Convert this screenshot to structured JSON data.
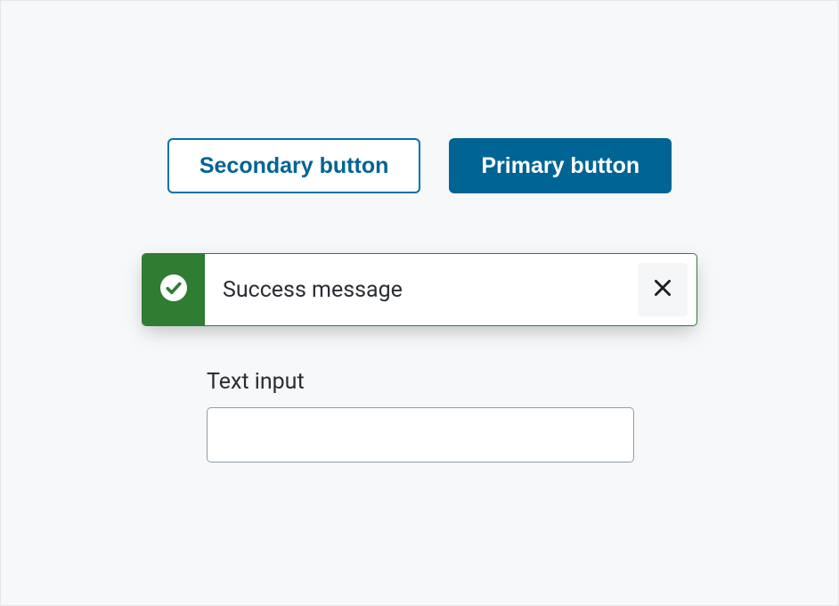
{
  "buttons": {
    "secondary_label": "Secondary button",
    "primary_label": "Primary button"
  },
  "alert": {
    "type": "success",
    "message": "Success message",
    "icon_name": "check-circle-icon",
    "close_icon_name": "close-icon",
    "accent_color": "#2e7d32"
  },
  "form": {
    "text_input": {
      "label": "Text input",
      "value": ""
    }
  },
  "colors": {
    "primary": "#006494",
    "success": "#2e7d32",
    "border": "#8f9ca8",
    "text": "#2a2e33",
    "frame_bg": "#f6f8f9"
  }
}
